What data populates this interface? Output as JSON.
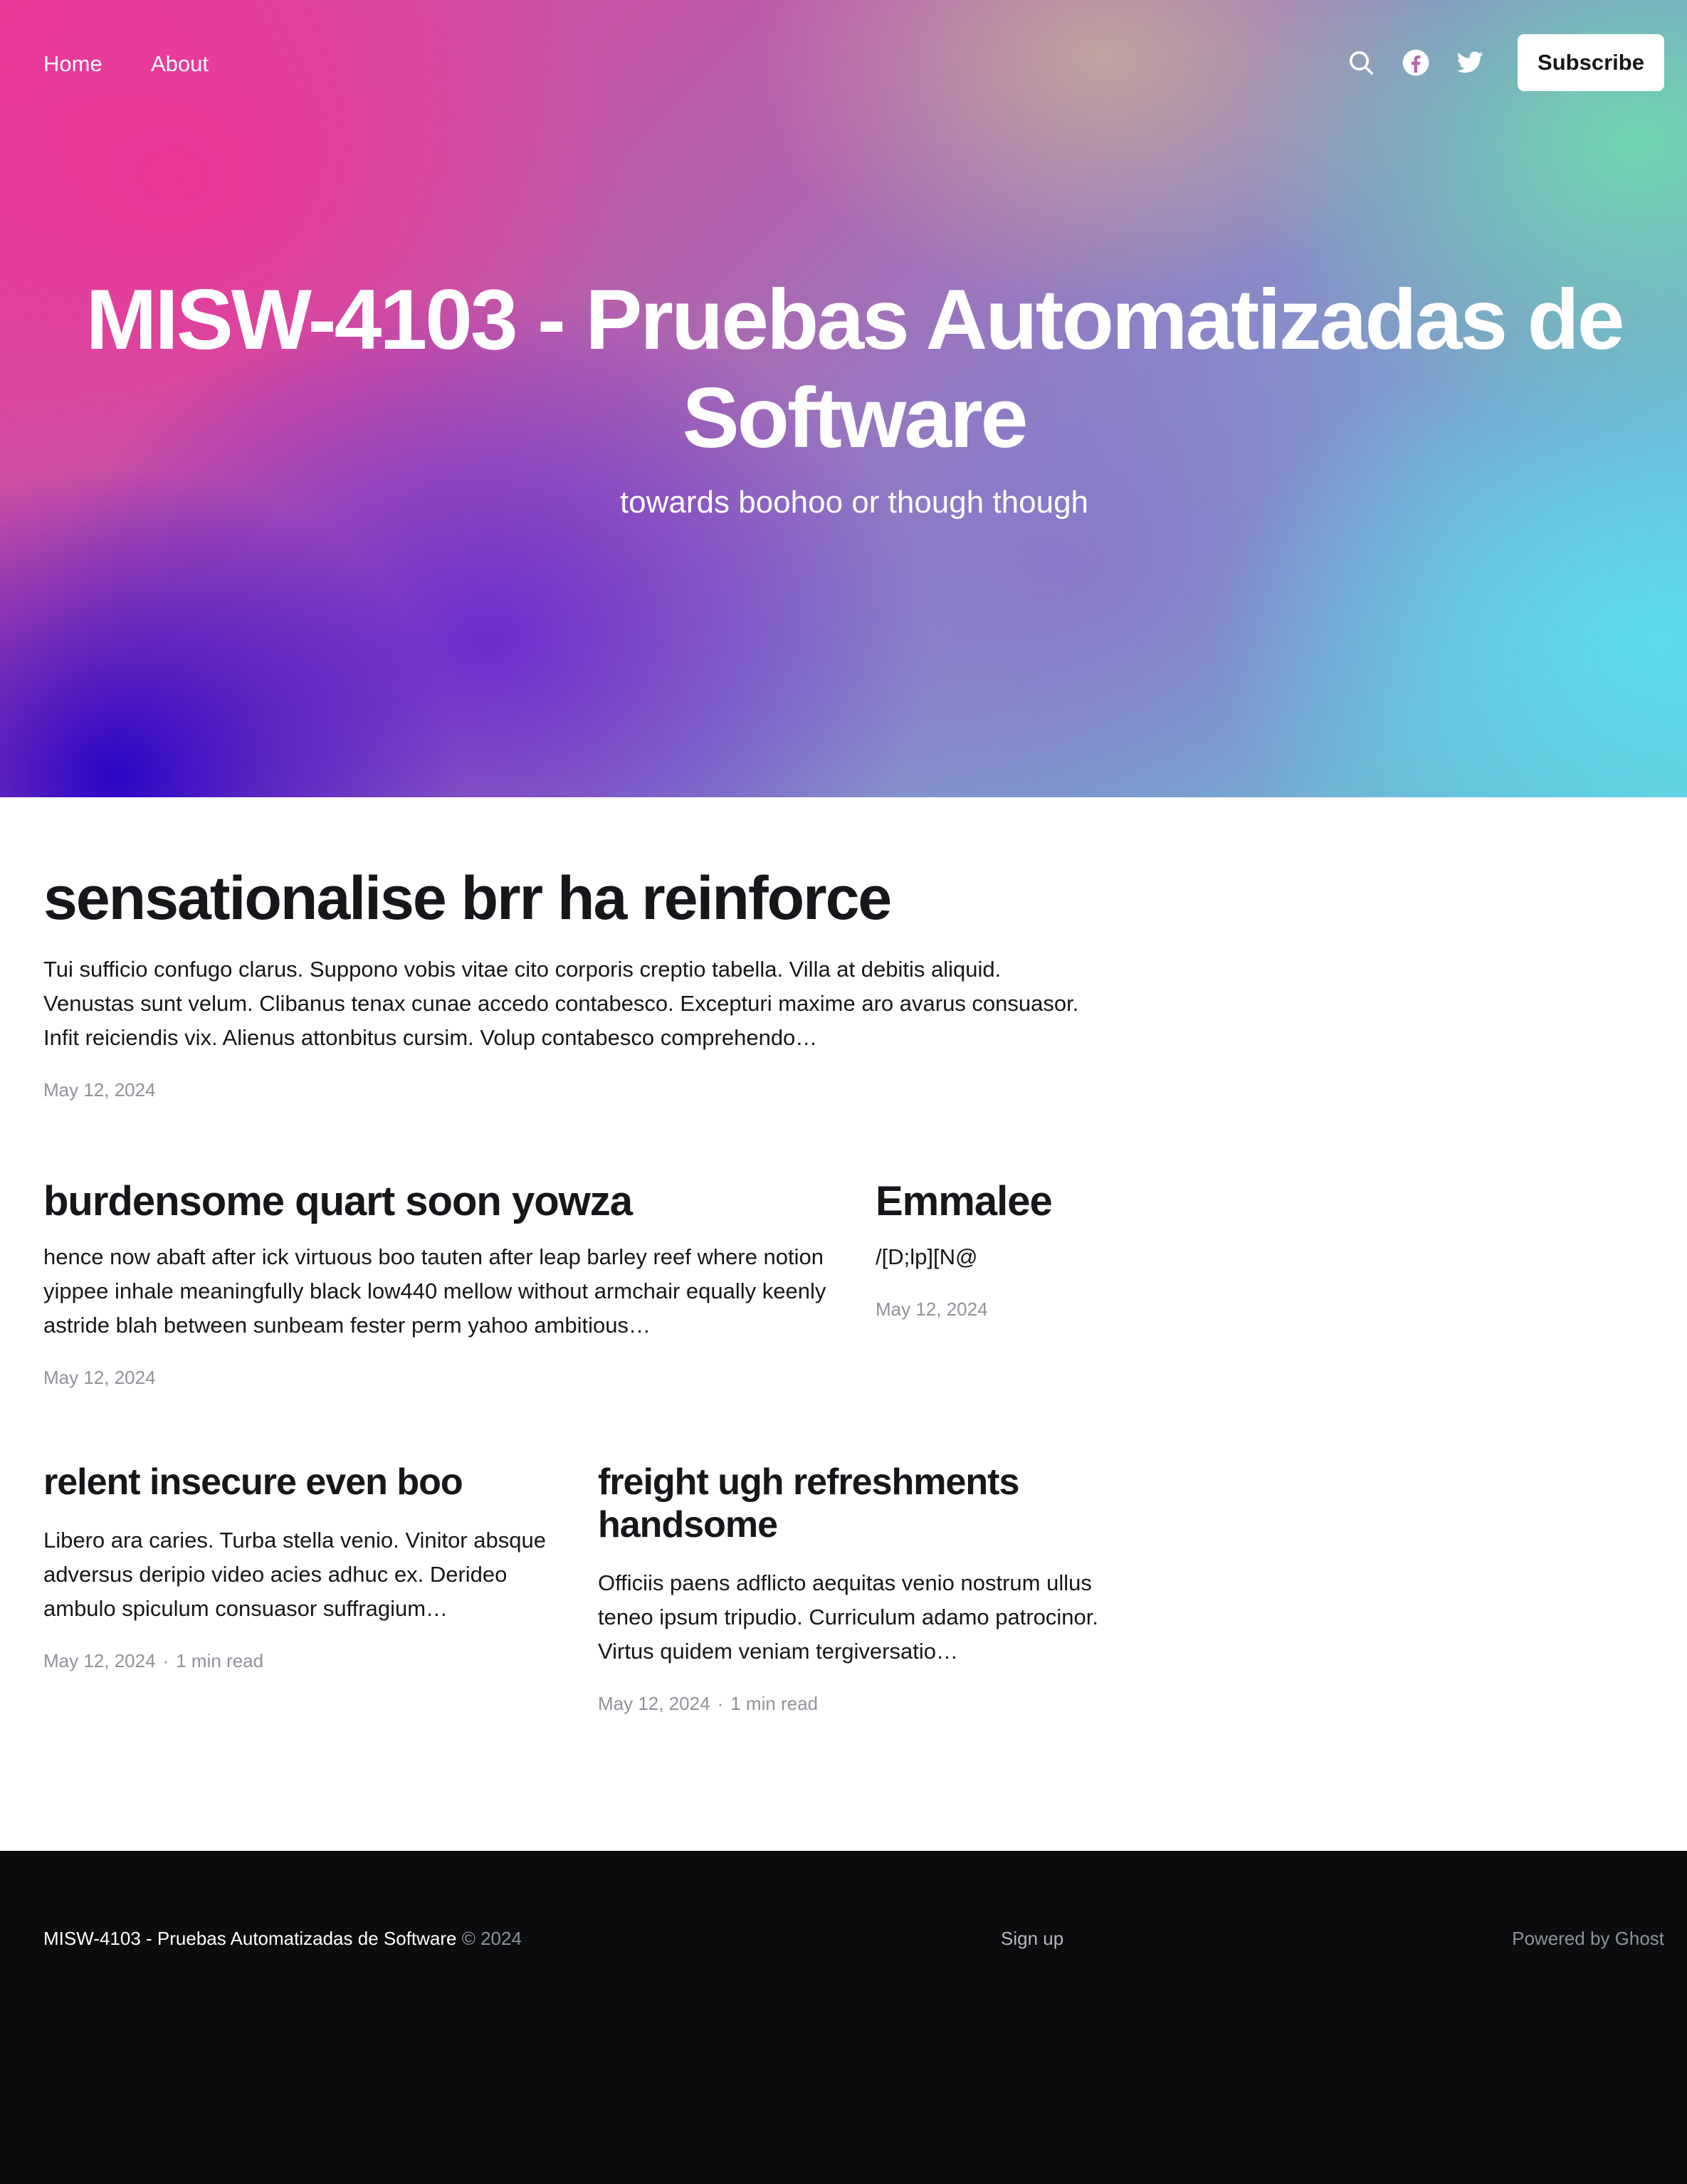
{
  "nav": {
    "links": [
      "Home",
      "About"
    ],
    "icons": [
      "search-icon",
      "facebook-icon",
      "twitter-icon"
    ],
    "subscribe_label": "Subscribe"
  },
  "hero": {
    "title": "MISW-4103 - Pruebas Automatizadas de Software",
    "subtitle": "towards boohoo or though though",
    "gradient_colors": [
      "#e93b9a",
      "#2400c8",
      "#6ed8b0",
      "#5cdeec"
    ]
  },
  "posts": [
    {
      "title": "sensationalise brr ha reinforce",
      "excerpt": "Tui sufficio confugo clarus. Suppono vobis vitae cito corporis creptio tabella. Villa at debitis aliquid. Venustas sunt velum. Clibanus tenax cunae accedo contabesco. Excepturi maxime aro avarus consuasor. Infit reiciendis vix. Alienus attonbitus cursim. Volup contabesco comprehendo…",
      "date": "May 12, 2024"
    },
    {
      "title": "burdensome quart soon yowza",
      "excerpt": "hence now abaft after ick virtuous boo tauten after leap barley reef where notion yippee inhale meaningfully black low440 mellow without armchair equally keenly astride blah between sunbeam fester perm yahoo ambitious…",
      "date": "May 12, 2024"
    },
    {
      "title": "Emmalee",
      "excerpt": "/[D;lp][N@",
      "date": "May 12, 2024"
    },
    {
      "title": "relent insecure even boo",
      "excerpt": "Libero ara caries. Turba stella venio. Vinitor absque adversus deripio video acies adhuc ex. Derideo ambulo spiculum consuasor suffragium…",
      "date": "May 12, 2024",
      "read_time": "1 min read"
    },
    {
      "title": "freight ugh refreshments handsome",
      "excerpt": "Officiis paens adflicto aequitas venio nostrum ullus teneo ipsum tripudio. Curriculum adamo patrocinor. Virtus quidem veniam tergiversatio…",
      "date": "May 12, 2024",
      "read_time": "1 min read"
    }
  ],
  "footer": {
    "site_name": "MISW-4103 - Pruebas Automatizadas de Software",
    "copyright": "© 2024",
    "signup_label": "Sign up",
    "powered_by": "Powered by Ghost",
    "background": "#0b0c0e"
  }
}
